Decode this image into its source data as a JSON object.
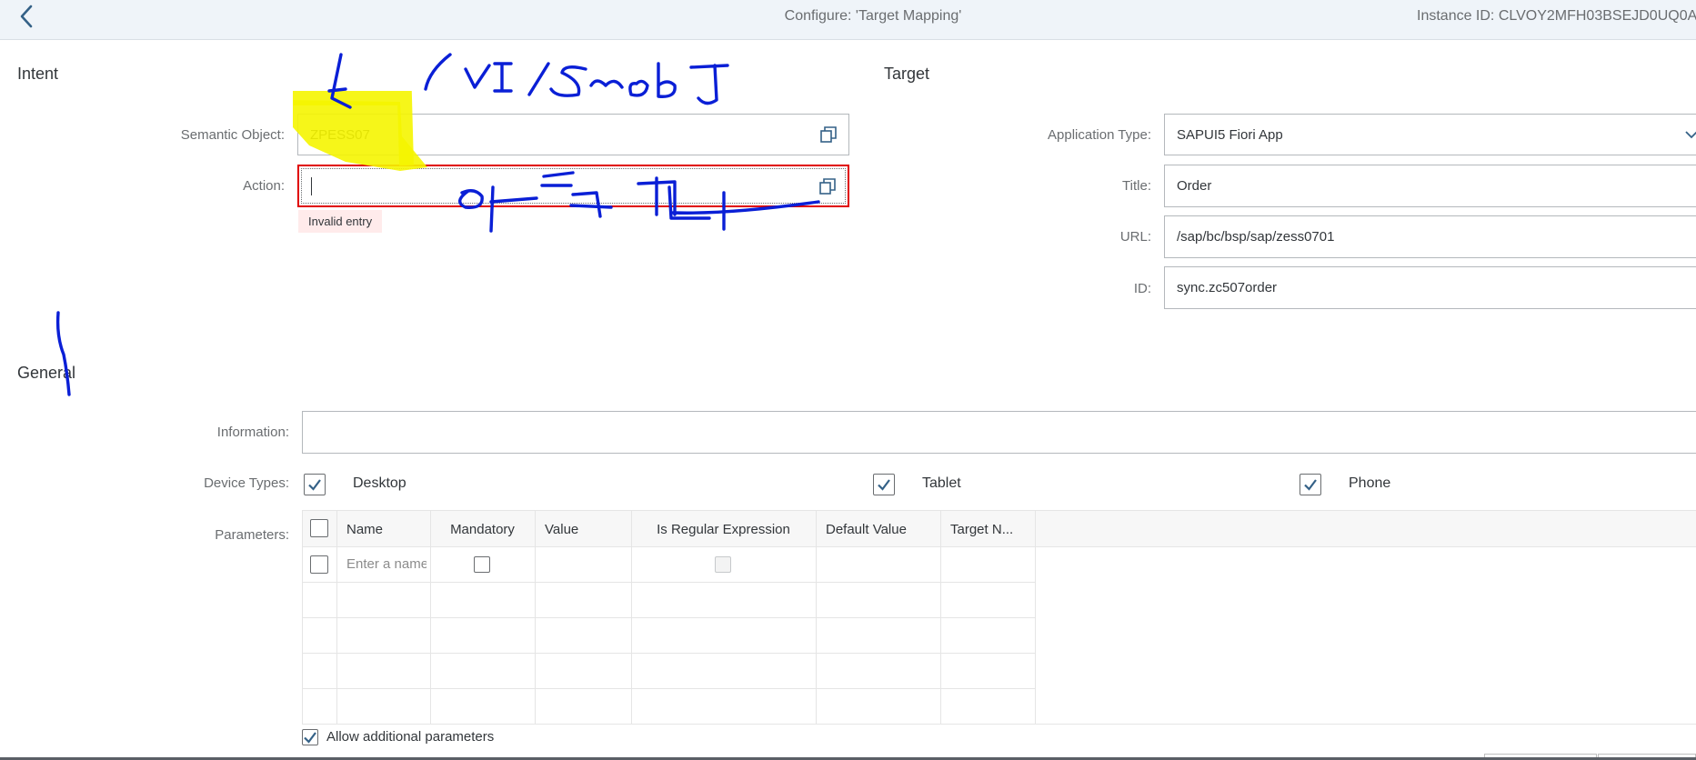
{
  "header": {
    "title": "Configure: 'Target Mapping'",
    "instance_id": "Instance ID: CLVOY2MFH03BSEJD0UQ0A"
  },
  "intent": {
    "section_title": "Intent",
    "semantic_object_label": "Semantic Object:",
    "semantic_object_value": "ZPESS07",
    "action_label": "Action:",
    "action_value": "",
    "action_error": "Invalid entry"
  },
  "target": {
    "section_title": "Target",
    "app_type_label": "Application Type:",
    "app_type_value": "SAPUI5 Fiori App",
    "title_label": "Title:",
    "title_value": "Order",
    "url_label": "URL:",
    "url_value": "/sap/bc/bsp/sap/zess0701",
    "id_label": "ID:",
    "id_value": "sync.zc507order"
  },
  "general": {
    "section_title": "General",
    "information_label": "Information:",
    "information_value": "",
    "device_types_label": "Device Types:",
    "devices": [
      {
        "label": "Desktop",
        "checked": true
      },
      {
        "label": "Tablet",
        "checked": true
      },
      {
        "label": "Phone",
        "checked": true
      }
    ],
    "parameters_label": "Parameters:",
    "columns": [
      "Name",
      "Mandatory",
      "Value",
      "Is Regular Expression",
      "Default Value",
      "Target N..."
    ],
    "name_placeholder": "Enter a name",
    "allow_additional_label": "Allow additional parameters"
  },
  "colors": {
    "accent": "#346187",
    "error": "#e00000",
    "highlight": "#f7f700",
    "ink": "#0a1fd6"
  }
}
